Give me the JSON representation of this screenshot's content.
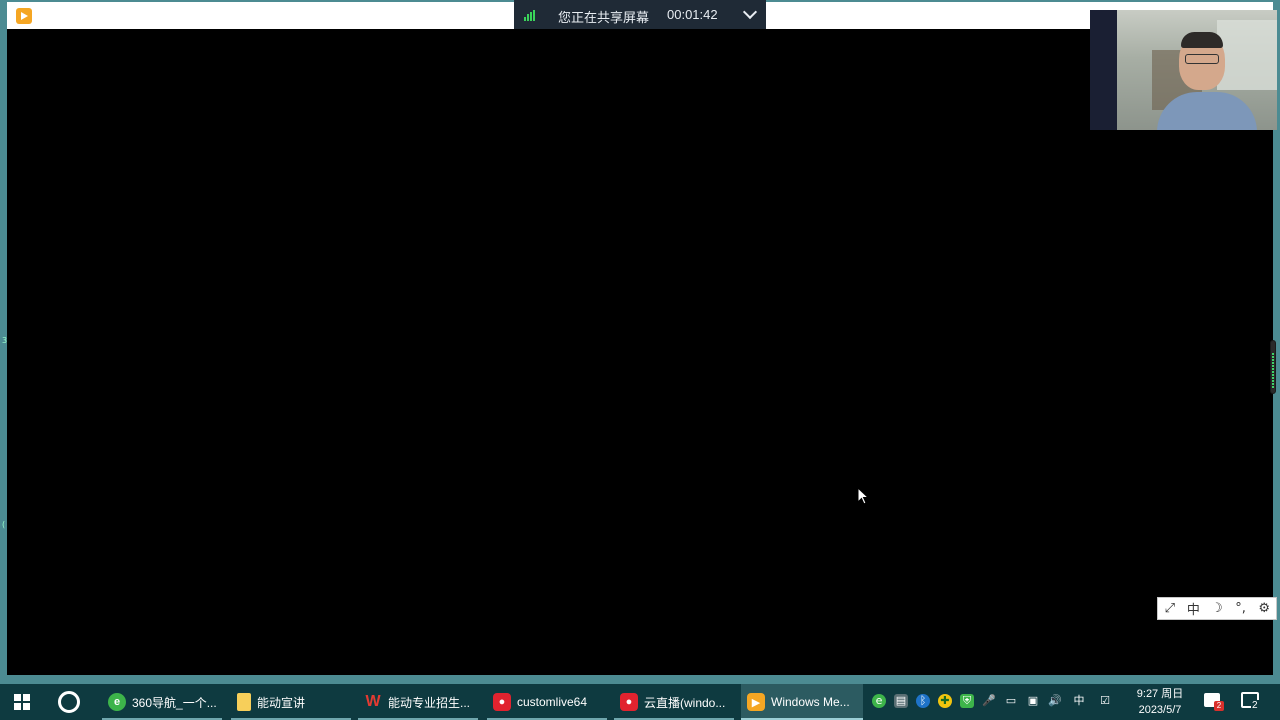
{
  "share_banner": {
    "status_text": "您正在共享屏幕",
    "timer": "00:01:42"
  },
  "side_markers": [
    "3",
    "("
  ],
  "ime_toolbar": [
    "⤢",
    "中",
    "☽",
    "°,",
    "⚙"
  ],
  "taskbar": {
    "items": [
      {
        "label": "360导航_一个...",
        "icon": "browser-360-icon",
        "glyph": "e"
      },
      {
        "label": "能动宣讲",
        "icon": "folder-icon",
        "glyph": ""
      },
      {
        "label": "能动专业招生...",
        "icon": "wps-icon",
        "glyph": "W"
      },
      {
        "label": "customlive64",
        "icon": "live-camera-icon",
        "glyph": "●"
      },
      {
        "label": "云直播(windo...",
        "icon": "live-camera-icon",
        "glyph": "●"
      },
      {
        "label": "Windows Me...",
        "icon": "media-player-icon",
        "glyph": "▶"
      }
    ],
    "tray_glyphs": [
      "e",
      "▤",
      "ᛒ",
      "✚",
      "⛨",
      "🎤",
      "▭",
      "▣",
      "🔊",
      "中",
      "☑"
    ],
    "clock": {
      "time": "9:27 周日",
      "date": "2023/5/7"
    },
    "notification_badge": "2",
    "action_center_count": "2"
  },
  "colors": {
    "desktop_teal": "#0e3a40",
    "banner_bg": "#1f2a36",
    "signal_green": "#3ad35a",
    "video_bg": "#000000"
  }
}
